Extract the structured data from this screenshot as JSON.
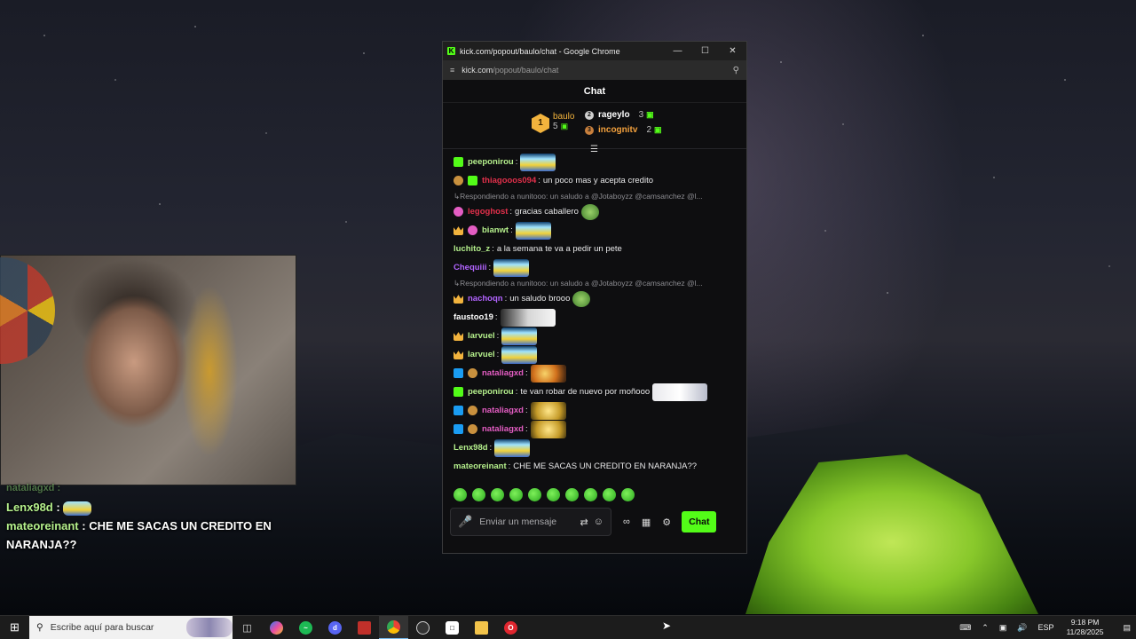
{
  "window": {
    "title": "kick.com/popout/baulo/chat - Google Chrome",
    "url_domain": "kick.com",
    "url_path": "/popout/baulo/chat"
  },
  "chat": {
    "header": "Chat",
    "leaderboard": {
      "first": {
        "rank": "1",
        "name": "baulo",
        "count": "5"
      },
      "others": [
        {
          "name": "rageylo",
          "count": "3",
          "color": "#ffffff"
        },
        {
          "name": "incognitv",
          "count": "2",
          "color": "#f2a03d"
        }
      ]
    },
    "messages": [
      {
        "badges": [
          "sub"
        ],
        "user": "peeponirou",
        "user_color": "#b5f08c",
        "text": "",
        "emote": "emote"
      },
      {
        "badges": [
          "og",
          "sub"
        ],
        "user": "thiagooos094",
        "user_color": "#e3304b",
        "text": "un poco mas y acepta credito",
        "emote": ""
      },
      {
        "reply": "Respondiendo a nunitooo: un saludo a @Jotaboyzz @camsanchez @l..."
      },
      {
        "badges": [
          "vip"
        ],
        "user": "legoghost",
        "user_color": "#e3304b",
        "text": "gracias caballero",
        "emote": "frog"
      },
      {
        "badges": [
          "crown",
          "vip"
        ],
        "user": "bianwt",
        "user_color": "#b5f08c",
        "text": "",
        "emote": "emote"
      },
      {
        "badges": [],
        "user": "luchito_z",
        "user_color": "#b5f08c",
        "text": "a la semana te va a pedir un pete",
        "emote": ""
      },
      {
        "badges": [],
        "user": "Chequiii",
        "user_color": "#b264ff",
        "text": "",
        "emote": "emote"
      },
      {
        "reply": "Respondiendo a nunitooo: un saludo a @Jotaboyzz @camsanchez @l..."
      },
      {
        "badges": [
          "crown"
        ],
        "user": "nachoqn",
        "user_color": "#b264ff",
        "text": "un saludo brooo",
        "emote": "frog"
      },
      {
        "badges": [],
        "user": "faustoo19",
        "user_color": "#ffffff",
        "text": "",
        "emote": "face"
      },
      {
        "badges": [
          "crown"
        ],
        "user": "larvuel",
        "user_color": "#b5f08c",
        "text": "",
        "emote": "emote"
      },
      {
        "badges": [
          "crown"
        ],
        "user": "larvuel",
        "user_color": "#b5f08c",
        "text": "",
        "emote": "emote"
      },
      {
        "badges": [
          "mod",
          "og"
        ],
        "user": "nataliagxd",
        "user_color": "#e45dc3",
        "text": "",
        "emote": "fire"
      },
      {
        "badges": [
          "sub"
        ],
        "user": "peeponirou",
        "user_color": "#b5f08c",
        "text": "te van robar de nuevo por moñooo",
        "emote": "white"
      },
      {
        "badges": [
          "mod",
          "og"
        ],
        "user": "nataliagxd",
        "user_color": "#e45dc3",
        "text": "",
        "emote": "cheese"
      },
      {
        "badges": [
          "mod",
          "og"
        ],
        "user": "nataliagxd",
        "user_color": "#e45dc3",
        "text": "",
        "emote": "cheese"
      },
      {
        "badges": [],
        "user": "Lenx98d",
        "user_color": "#b5f08c",
        "text": "",
        "emote": "emote"
      },
      {
        "badges": [],
        "user": "mateoreinant",
        "user_color": "#b5f08c",
        "text": "CHE ME SACAS UN CREDITO EN NARANJA??",
        "emote": ""
      }
    ],
    "input_placeholder": "Enviar un mensaje",
    "send_label": "Chat"
  },
  "overlay": {
    "faded_line": "nataliagxd :",
    "line1_user": "Lenx98d",
    "line2_user": "mateoreinant",
    "line2_text": "CHE ME SACAS UN CREDITO EN NARANJA??"
  },
  "taskbar": {
    "search_placeholder": "Escribe aquí para buscar",
    "language": "ESP",
    "time": "9:18 PM",
    "date": "11/28/2025"
  }
}
